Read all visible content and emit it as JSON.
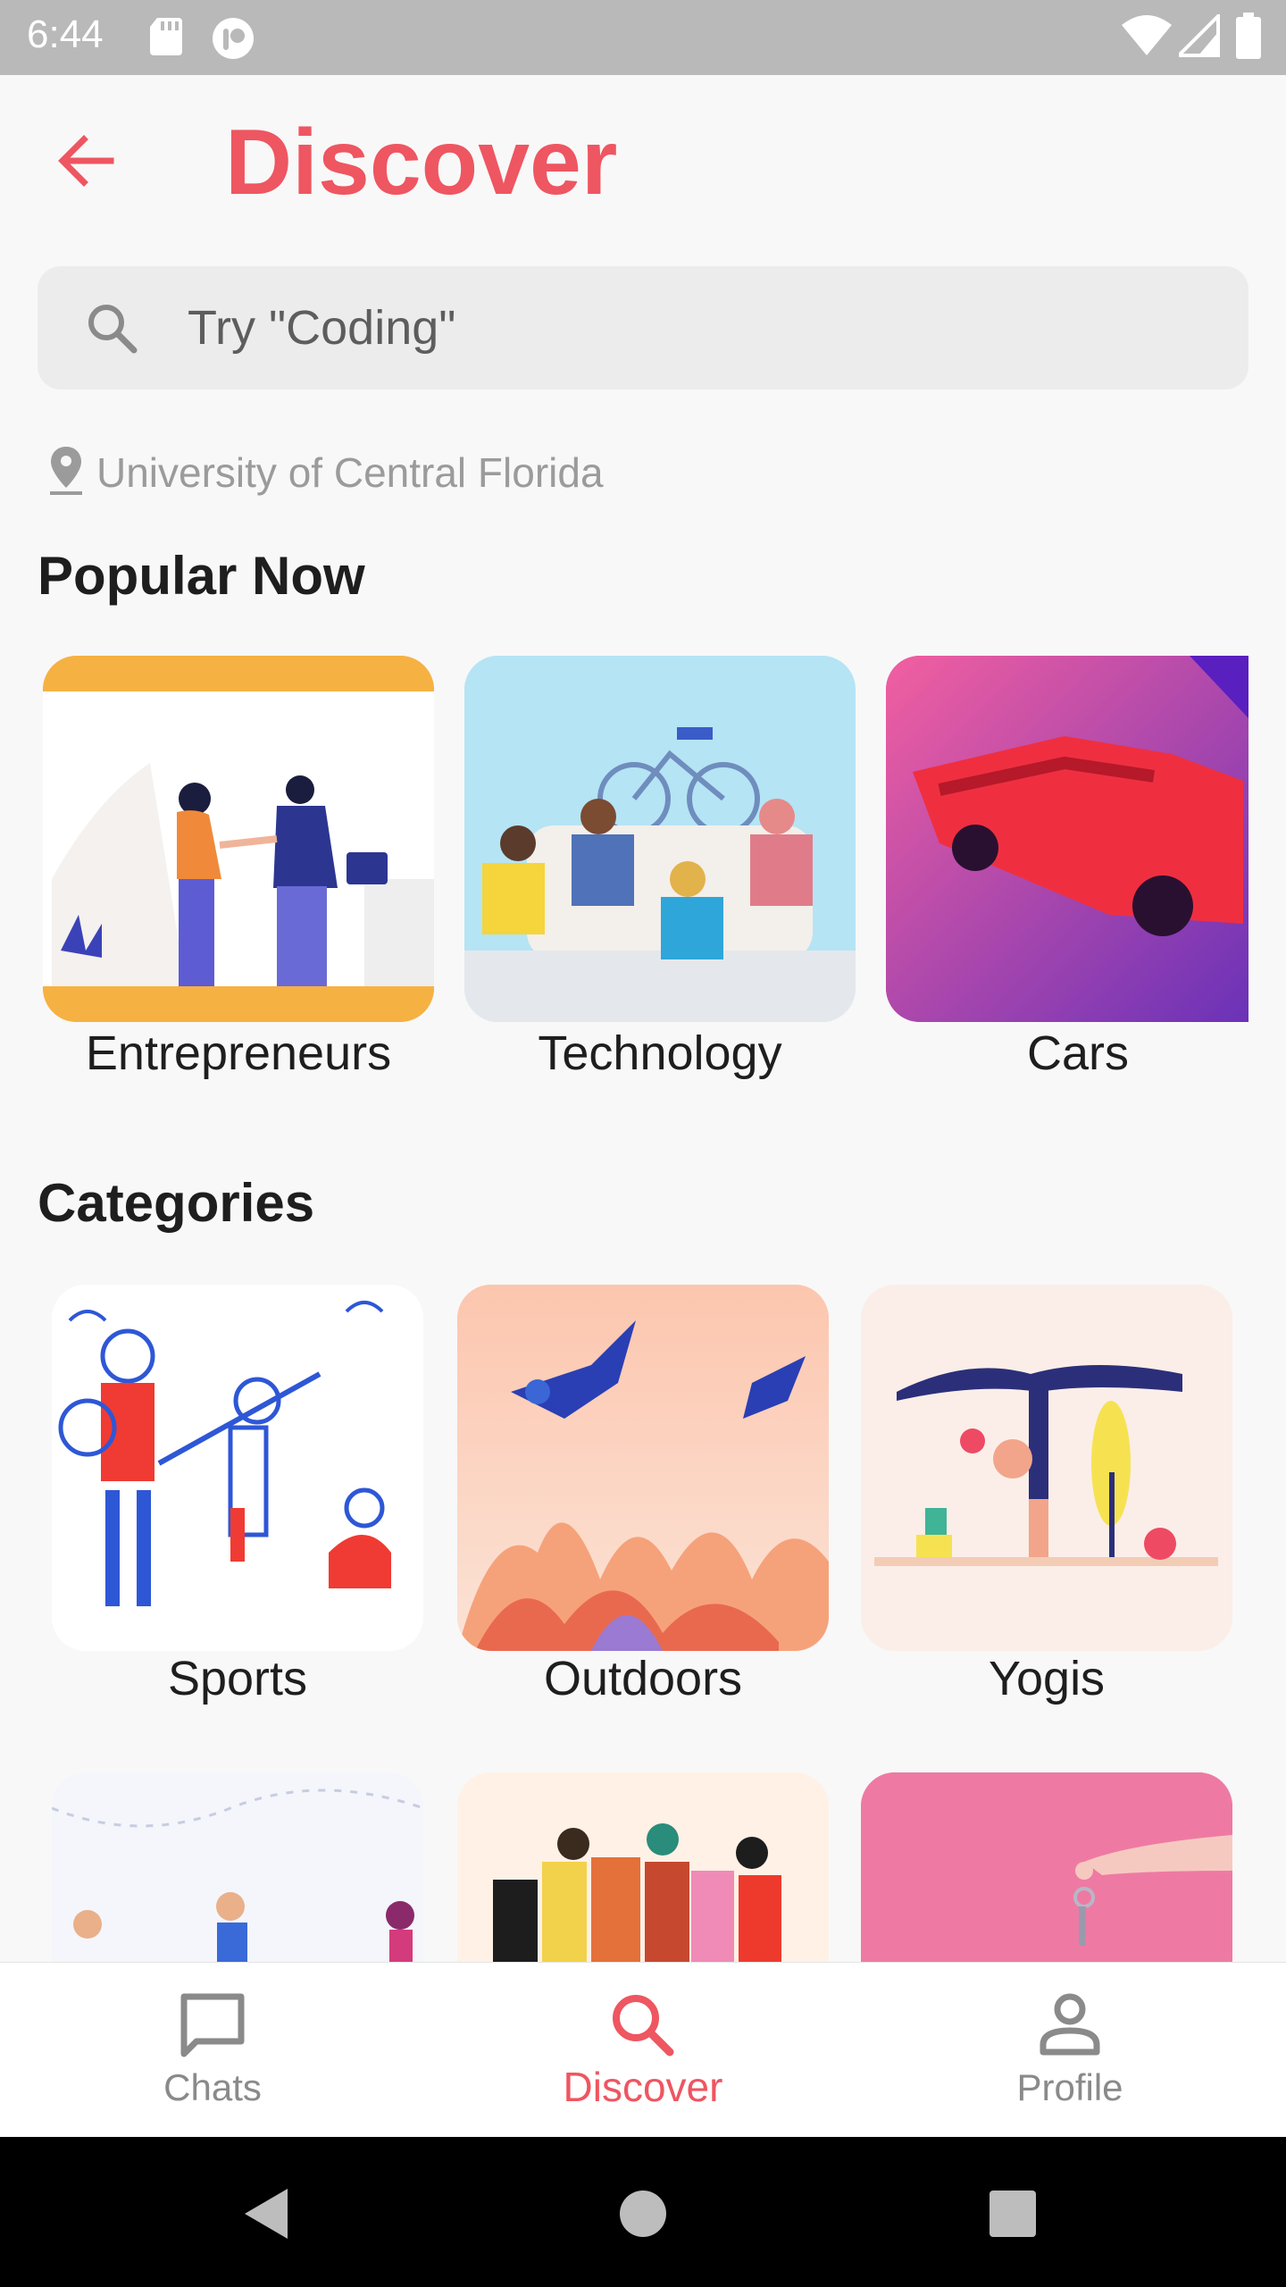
{
  "status_bar": {
    "time": "6:44"
  },
  "header": {
    "title": "Discover"
  },
  "search": {
    "placeholder": "Try \"Coding\""
  },
  "location": {
    "text": "University of Central Florida"
  },
  "popular": {
    "heading": "Popular Now",
    "items": [
      {
        "label": "Entrepreneurs"
      },
      {
        "label": "Technology"
      },
      {
        "label": "Cars"
      }
    ]
  },
  "categories": {
    "heading": "Categories",
    "items": [
      {
        "label": "Sports"
      },
      {
        "label": "Outdoors"
      },
      {
        "label": "Yogis"
      }
    ]
  },
  "bottom_nav": {
    "items": [
      {
        "label": "Chats",
        "icon": "chat-icon"
      },
      {
        "label": "Discover",
        "icon": "search-icon"
      },
      {
        "label": "Profile",
        "icon": "person-icon"
      }
    ],
    "active": "Discover"
  },
  "colors": {
    "accent": "#ee5661",
    "status_bar": "#b9b9b9",
    "search_bg": "#ececec",
    "text_primary": "#1e1e1e",
    "text_muted": "#9b9b9b"
  }
}
